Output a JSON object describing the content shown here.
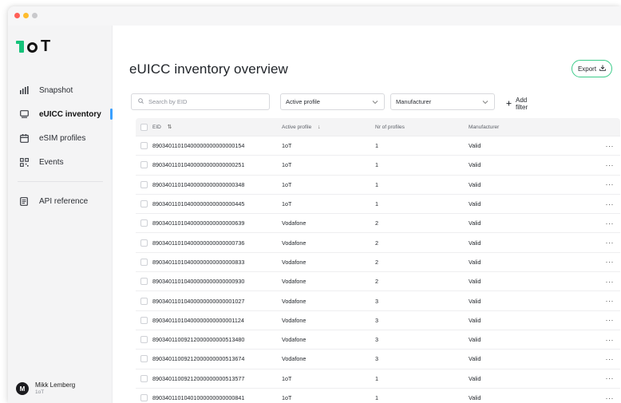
{
  "window": {
    "logo_text": "1oT"
  },
  "sidebar": {
    "items": [
      {
        "label": "Snapshot",
        "icon": "bar-chart-icon"
      },
      {
        "label": "eUICC inventory",
        "icon": "monitor-icon",
        "active": true
      },
      {
        "label": "eSIM profiles",
        "icon": "calendar-card-icon"
      },
      {
        "label": "Events",
        "icon": "qr-grid-icon"
      }
    ],
    "secondary_items": [
      {
        "label": "API reference",
        "icon": "document-icon"
      }
    ],
    "user": {
      "initial": "M",
      "name": "Mikk Lemberg",
      "org": "1oT"
    }
  },
  "main": {
    "title": "eUICC inventory overview",
    "export_label": "Export",
    "search_placeholder": "Search by EID",
    "filter_active_profile": "Active profile",
    "filter_manufacturer": "Manufacturer",
    "add_filter_label": "Add filter"
  },
  "table": {
    "columns": {
      "eid": "EID",
      "active_profile": "Active profile",
      "nr_profiles": "Nr of profiles",
      "manufacturer": "Manufacturer"
    },
    "rows": [
      {
        "eid": "89034011010400000000000000154",
        "profile": "1oT",
        "count": "1",
        "manufacturer": "Valid"
      },
      {
        "eid": "89034011010400000000000000251",
        "profile": "1oT",
        "count": "1",
        "manufacturer": "Valid"
      },
      {
        "eid": "89034011010400000000000000348",
        "profile": "1oT",
        "count": "1",
        "manufacturer": "Valid"
      },
      {
        "eid": "89034011010400000000000000445",
        "profile": "1oT",
        "count": "1",
        "manufacturer": "Valid"
      },
      {
        "eid": "89034011010400000000000000639",
        "profile": "Vodafone",
        "count": "2",
        "manufacturer": "Valid"
      },
      {
        "eid": "89034011010400000000000000736",
        "profile": "Vodafone",
        "count": "2",
        "manufacturer": "Valid"
      },
      {
        "eid": "89034011010400000000000000833",
        "profile": "Vodafone",
        "count": "2",
        "manufacturer": "Valid"
      },
      {
        "eid": "89034011010400000000000000930",
        "profile": "Vodafone",
        "count": "2",
        "manufacturer": "Valid"
      },
      {
        "eid": "89034011010400000000000001027",
        "profile": "Vodafone",
        "count": "3",
        "manufacturer": "Valid"
      },
      {
        "eid": "89034011010400000000000001124",
        "profile": "Vodafone",
        "count": "3",
        "manufacturer": "Valid"
      },
      {
        "eid": "89034011009212000000000513480",
        "profile": "Vodafone",
        "count": "3",
        "manufacturer": "Valid"
      },
      {
        "eid": "89034011009212000000000513674",
        "profile": "Vodafone",
        "count": "3",
        "manufacturer": "Valid"
      },
      {
        "eid": "89034011009212000000000513577",
        "profile": "1oT",
        "count": "1",
        "manufacturer": "Valid"
      },
      {
        "eid": "89034011010401000000000000841",
        "profile": "1oT",
        "count": "1",
        "manufacturer": "Valid"
      }
    ],
    "more_label": "···"
  },
  "colors": {
    "accent_green": "#16c27a",
    "active_indicator": "#3aa0ff",
    "export_border": "#3ccc8a"
  }
}
